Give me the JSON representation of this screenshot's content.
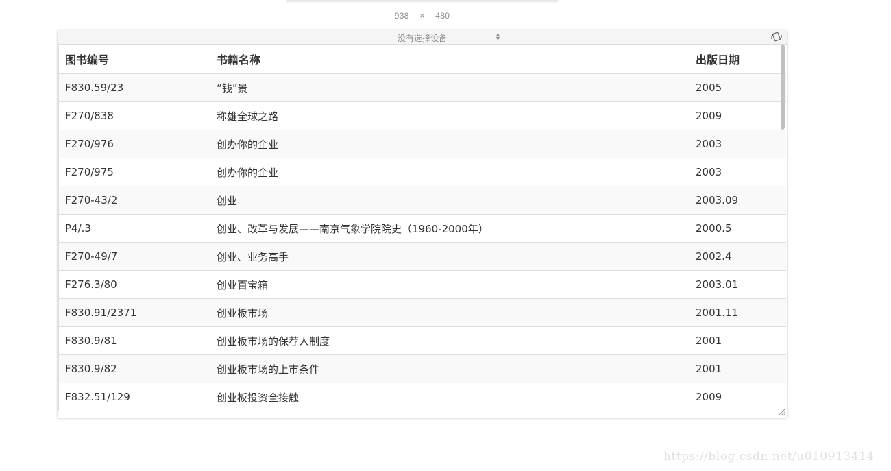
{
  "viewport_size": {
    "width": "938",
    "separator": "×",
    "height": "480"
  },
  "device_bar": {
    "device_select_label": "没有选择设备",
    "rotate_icon": "rotate-device-icon"
  },
  "table": {
    "columns": [
      "图书编号",
      "书籍名称",
      "出版日期"
    ],
    "rows": [
      [
        "F830.59/23",
        "“钱”景",
        "2005"
      ],
      [
        "F270/838",
        "称雄全球之路",
        "2009"
      ],
      [
        "F270/976",
        "创办你的企业",
        "2003"
      ],
      [
        "F270/975",
        "创办你的企业",
        "2003"
      ],
      [
        "F270-43/2",
        "创业",
        "2003.09"
      ],
      [
        "P4/.3",
        "创业、改革与发展——南京气象学院院史（1960-2000年）",
        "2000.5"
      ],
      [
        "F270-49/7",
        "创业、业务高手",
        "2002.4"
      ],
      [
        "F276.3/80",
        "创业百宝箱",
        "2003.01"
      ],
      [
        "F830.91/2371",
        "创业板市场",
        "2001.11"
      ],
      [
        "F830.9/81",
        "创业板市场的保荐人制度",
        "2001"
      ],
      [
        "F830.9/82",
        "创业板市场的上市条件",
        "2001"
      ],
      [
        "F832.51/129",
        "创业板投资全接触",
        "2009"
      ]
    ]
  },
  "watermark": "https://blog.csdn.net/u010913414",
  "colors": {
    "border": "#dddddd",
    "stripe": "#f9f9f9",
    "text": "#333333",
    "muted": "#8a8a8a"
  }
}
